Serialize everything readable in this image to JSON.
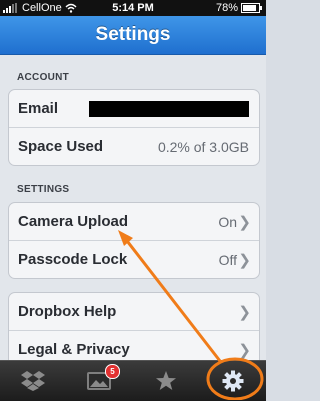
{
  "status_bar": {
    "carrier": "CellOne",
    "time": "5:14 PM",
    "battery": "78%"
  },
  "nav": {
    "title": "Settings"
  },
  "account_section": {
    "header": "ACCOUNT",
    "email_label": "Email",
    "space_label": "Space Used",
    "space_value": "0.2% of 3.0GB"
  },
  "settings_section": {
    "header": "SETTINGS",
    "camera_label": "Camera Upload",
    "camera_value": "On",
    "passcode_label": "Passcode Lock",
    "passcode_value": "Off"
  },
  "help_section": {
    "help_label": "Dropbox Help",
    "legal_label": "Legal & Privacy"
  },
  "tab_bar": {
    "photos_badge": "5",
    "tabs": [
      "dropbox-icon",
      "photos-icon",
      "star-icon",
      "gear-icon"
    ]
  },
  "colors": {
    "nav_blue": "#2a7fdb",
    "annotation_orange": "#f07c19"
  }
}
